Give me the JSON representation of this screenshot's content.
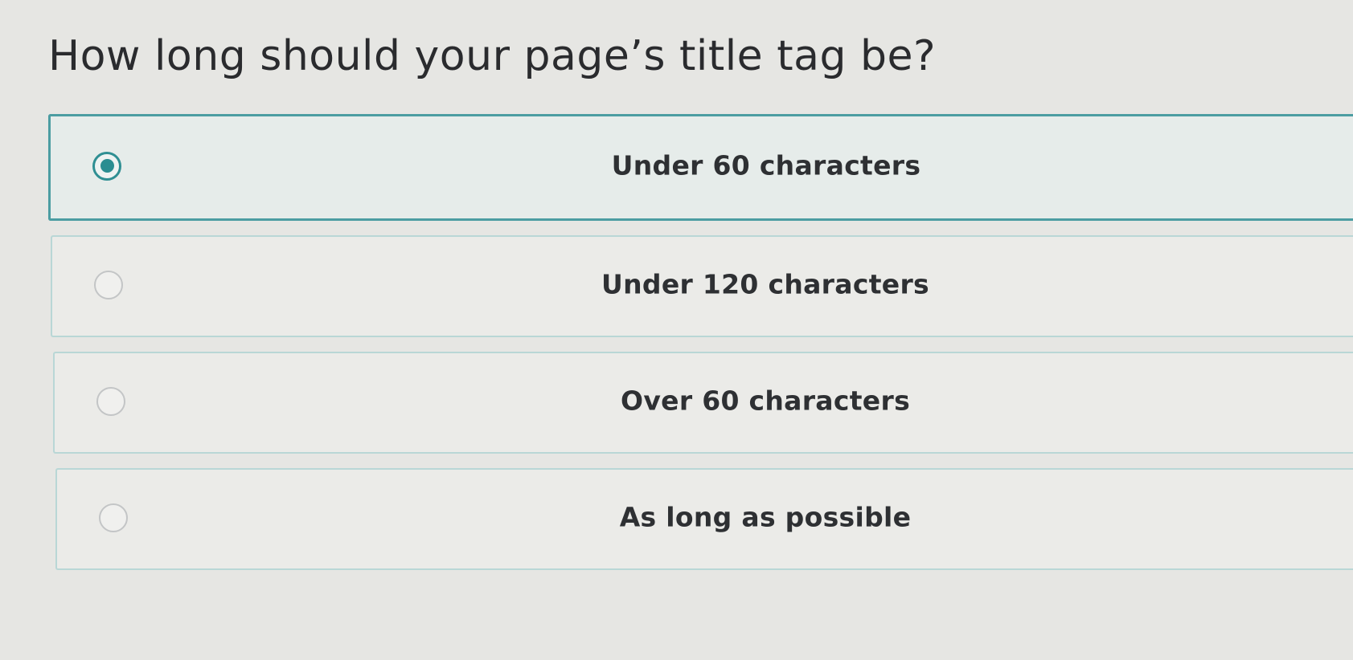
{
  "question": {
    "text": "How long should your page’s title tag be?"
  },
  "options": [
    {
      "label": "Under 60 characters",
      "selected": true
    },
    {
      "label": "Under 120 characters",
      "selected": false
    },
    {
      "label": "Over 60 characters",
      "selected": false
    },
    {
      "label": "As long as possible",
      "selected": false
    }
  ],
  "colors": {
    "accent": "#2a8d91",
    "selected_border": "#4c9da2",
    "option_border": "#b9d7d6",
    "background": "#e6e6e3"
  }
}
